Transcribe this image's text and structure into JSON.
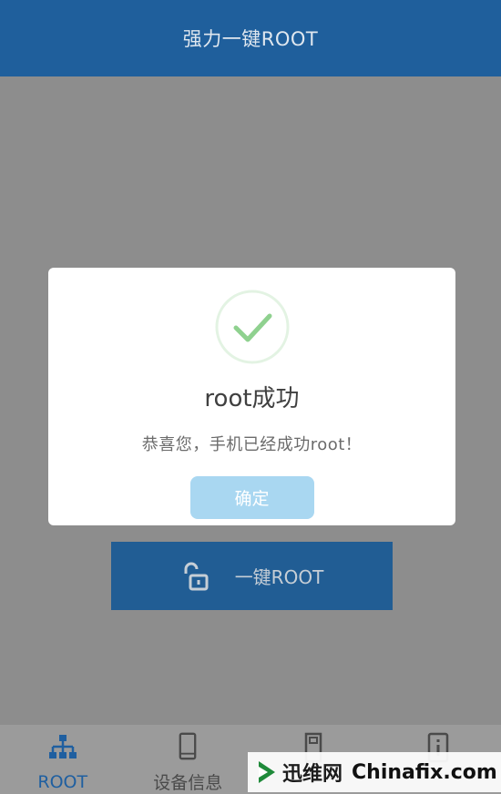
{
  "header": {
    "title": "强力一键ROOT"
  },
  "main": {
    "root_button_label": "一键ROOT"
  },
  "dialog": {
    "icon": "checkmark-circle-icon",
    "title": "root成功",
    "message": "恭喜您，手机已经成功root！",
    "confirm_label": "确定"
  },
  "bottom_nav": {
    "items": [
      {
        "label": "ROOT",
        "icon": "hierarchy-icon",
        "active": true
      },
      {
        "label": "设备信息",
        "icon": "phone-icon",
        "active": false
      },
      {
        "label": "",
        "icon": "sd-card-icon",
        "active": false
      },
      {
        "label": "",
        "icon": "info-icon",
        "active": false
      }
    ]
  },
  "watermark": {
    "cn": "迅维网",
    "en": "Chinafix.com"
  },
  "colors": {
    "header": "#1f5f9c",
    "root_button": "#215d94",
    "confirm_button": "#a9d7f1",
    "check_green": "#8fd18f"
  }
}
